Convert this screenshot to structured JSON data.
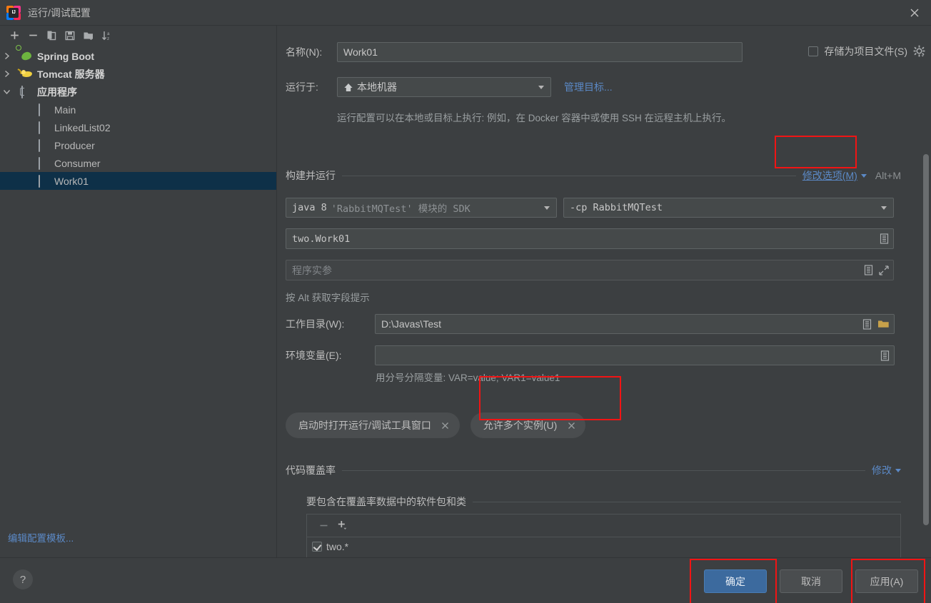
{
  "window": {
    "title": "运行/调试配置",
    "app_icon": "intellij-idea-icon",
    "close_icon": "close-icon"
  },
  "sidebar": {
    "toolbar": [
      {
        "name": "add-configuration-button",
        "icon": "plus-icon"
      },
      {
        "name": "remove-configuration-button",
        "icon": "minus-icon"
      },
      {
        "name": "copy-configuration-button",
        "icon": "copy-icon"
      },
      {
        "name": "save-configuration-button",
        "icon": "save-icon"
      },
      {
        "name": "move-into-folder-button",
        "icon": "new-folder-icon"
      },
      {
        "name": "sort-configurations-button",
        "icon": "sort-alphabetically-icon"
      }
    ],
    "tree": [
      {
        "label": "Spring Boot",
        "icon": "spring-boot-icon",
        "expanded": false,
        "level": 0,
        "bold": true
      },
      {
        "label": "Tomcat 服务器",
        "icon": "tomcat-icon",
        "expanded": false,
        "level": 0,
        "bold": true
      },
      {
        "label": "应用程序",
        "icon": "application-icon",
        "expanded": true,
        "level": 0,
        "bold": true
      },
      {
        "label": "Main",
        "icon": "application-icon",
        "level": 1,
        "selected": false
      },
      {
        "label": "LinkedList02",
        "icon": "application-icon",
        "level": 1,
        "selected": false
      },
      {
        "label": "Producer",
        "icon": "application-icon",
        "level": 1,
        "selected": false
      },
      {
        "label": "Consumer",
        "icon": "application-icon",
        "level": 1,
        "selected": false
      },
      {
        "label": "Work01",
        "icon": "application-icon",
        "level": 1,
        "selected": true
      }
    ],
    "edit_templates_link": "编辑配置模板..."
  },
  "form": {
    "name_label": "名称(N):",
    "name_value": "Work01",
    "store_as_project_file_label": "存储为项目文件(S)",
    "store_as_project_file_checked": false,
    "gear_icon": "gear-icon",
    "run_on_label": "运行于:",
    "run_on_value": "本地机器",
    "run_on_icon": "local-machine-icon",
    "manage_targets_link": "管理目标...",
    "target_hint": "运行配置可以在本地或目标上执行: 例如，在 Docker 容器中或使用 SSH 在远程主机上执行。",
    "build_and_run": {
      "title": "构建并运行",
      "modify_options_link": "修改选项(M)",
      "modify_options_shortcut": "Alt+M",
      "sdk_prefix": "java 8",
      "sdk_suffix": "'RabbitMQTest' 模块的 SDK",
      "classpath_value": "-cp RabbitMQTest",
      "main_class_value": "two.Work01",
      "program_args_placeholder": "程序实参",
      "field_hint": "按 Alt 获取字段提示",
      "expand_icon": "expand-icon",
      "macro_icon": "insert-macro-icon"
    },
    "working_dir_label": "工作目录(W):",
    "working_dir_value": "D:\\Javas\\Test",
    "working_dir_browse_icon": "folder-browse-icon",
    "env_vars_label": "环境变量(E):",
    "env_vars_value": "",
    "env_vars_hint": "用分号分隔变量: VAR=value; VAR1=value1",
    "chips": [
      {
        "label": "启动时打开运行/调试工具窗口",
        "remove_icon": "close-icon",
        "highlighted": false
      },
      {
        "label": "允许多个实例(U)",
        "remove_icon": "close-icon",
        "highlighted": true
      }
    ],
    "coverage": {
      "title": "代码覆盖率",
      "modify_link": "修改",
      "sub_title": "要包含在覆盖率数据中的软件包和类",
      "toolbar": [
        {
          "name": "coverage-remove-button",
          "icon": "minus-icon",
          "disabled": true
        },
        {
          "name": "coverage-add-button",
          "icon": "plus-dropdown-icon",
          "disabled": false
        }
      ],
      "items": [
        {
          "label": "two.*",
          "checked": true
        }
      ]
    }
  },
  "footer": {
    "help_label": "?",
    "ok_label": "确定",
    "cancel_label": "取消",
    "apply_label": "应用(A)"
  },
  "colors": {
    "window_bg": "#3c3f41",
    "field_bg": "#45494a",
    "border": "#5e6364",
    "link": "#5b89c6",
    "selection": "#0e3048",
    "primary_button": "#3c6a9e",
    "annotation_red": "#f11414",
    "text": "#bcbcbc"
  }
}
